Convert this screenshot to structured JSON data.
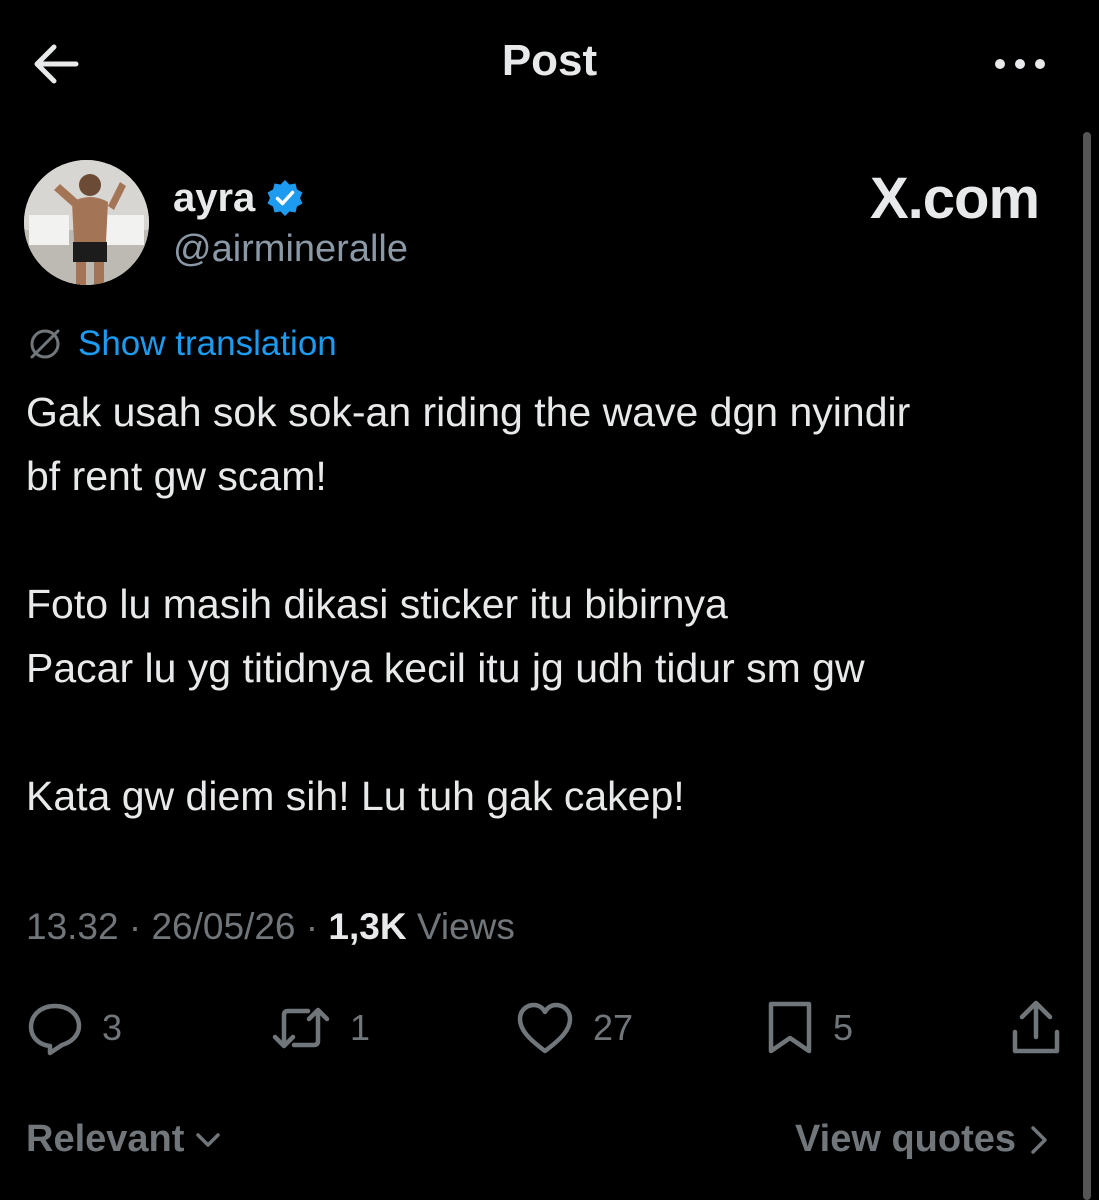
{
  "header": {
    "title": "Post",
    "back_icon": "arrow-left-icon",
    "more_icon": "more-horizontal-icon"
  },
  "author": {
    "name": "ayra",
    "handle": "@airmineralle",
    "verified_icon": "verified-badge-icon",
    "verified_color": "#1d9bf0"
  },
  "watermark": "X.com",
  "translation": {
    "label": "Show translation",
    "icon": "translate-globe-icon"
  },
  "post": {
    "lines": [
      "Gak usah sok sok-an riding the wave dgn nyindir",
      "bf rent gw scam!",
      "",
      "Foto lu masih dikasi sticker itu bibirnya",
      "Pacar lu yg titidnya kecil itu jg udh tidur sm gw",
      "",
      "Kata gw diem sih! Lu tuh gak cakep!"
    ]
  },
  "meta": {
    "time": "13.32",
    "sep1": " · ",
    "date": "26/05/26",
    "sep2": " · ",
    "views_count": "1,3K",
    "views_label": " Views"
  },
  "actions": {
    "replies": "3",
    "reposts": "1",
    "likes": "27",
    "bookmarks": "5"
  },
  "footer": {
    "sort_label": "Relevant",
    "quotes_label": "View quotes"
  },
  "colors": {
    "background": "#000000",
    "text": "#e7e9ea",
    "secondary": "#71767b",
    "accent": "#1d9bf0"
  }
}
